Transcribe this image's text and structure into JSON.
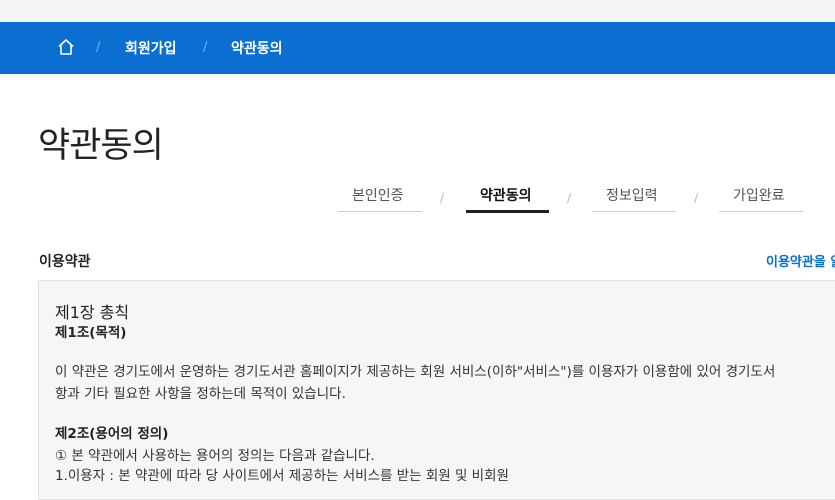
{
  "breadcrumb": {
    "items": [
      "회원가입",
      "약관동의"
    ]
  },
  "page": {
    "title": "약관동의"
  },
  "steps": [
    "본인인증",
    "약관동의",
    "정보입력",
    "가입완료"
  ],
  "active_step_index": 1,
  "section": {
    "title": "이용약관",
    "link": "이용약관을 읽"
  },
  "terms": {
    "chapter": "제1장 총칙",
    "article1_title": "제1조(목적)",
    "article1_line1": "이 약관은 경기도에서 운영하는 경기도서관 홈페이지가 제공하는 회원 서비스(이하\"서비스\")를 이용자가 이용함에 있어 경기도서",
    "article1_line2": "항과 기타 필요한 사항을 정하는데 목적이 있습니다.",
    "article2_title": "제2조(용어의 정의)",
    "article2_line1": "① 본 약관에서 사용하는 용어의 정의는 다음과 같습니다.",
    "article2_line2": "1.이용자 : 본 약관에 따라 당 사이트에서 제공하는 서비스를 받는 회원 및 비회원"
  },
  "colors": {
    "accent": "#0a6fd0",
    "topstrip": "#f4f4f4",
    "box": "#f6f6f6"
  }
}
